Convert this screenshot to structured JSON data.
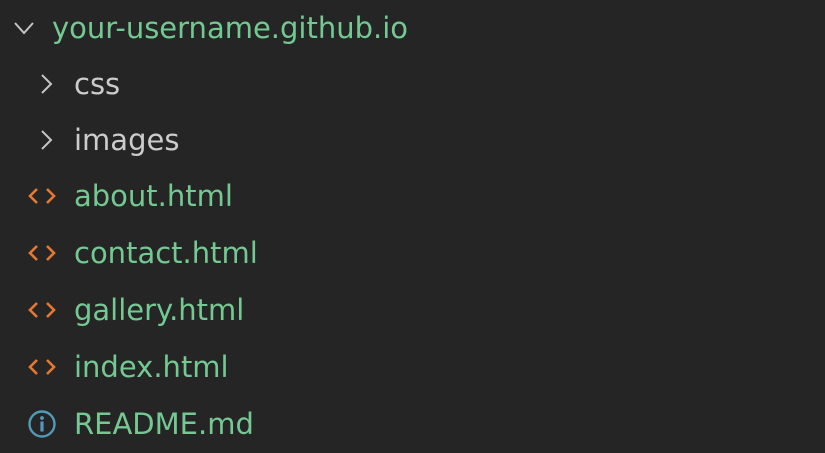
{
  "explorer": {
    "root": {
      "label": "your-username.github.io",
      "expanded": true,
      "twistie_icon": "chevron-down-icon"
    },
    "items": [
      {
        "label": "css",
        "type": "folder",
        "icon": "chevron-right-icon"
      },
      {
        "label": "images",
        "type": "folder",
        "icon": "chevron-right-icon"
      },
      {
        "label": "about.html",
        "type": "file",
        "icon": "html-icon"
      },
      {
        "label": "contact.html",
        "type": "file",
        "icon": "html-icon"
      },
      {
        "label": "gallery.html",
        "type": "file",
        "icon": "html-icon"
      },
      {
        "label": "index.html",
        "type": "file",
        "icon": "html-icon"
      },
      {
        "label": "README.md",
        "type": "file",
        "icon": "info-icon"
      }
    ]
  },
  "colors": {
    "background": "#252526",
    "untracked_text": "#73C991",
    "folder_text": "#CCCCCC",
    "chevron": "#C5C5C5",
    "html_icon": "#E37933",
    "info_icon": "#519ABA"
  }
}
